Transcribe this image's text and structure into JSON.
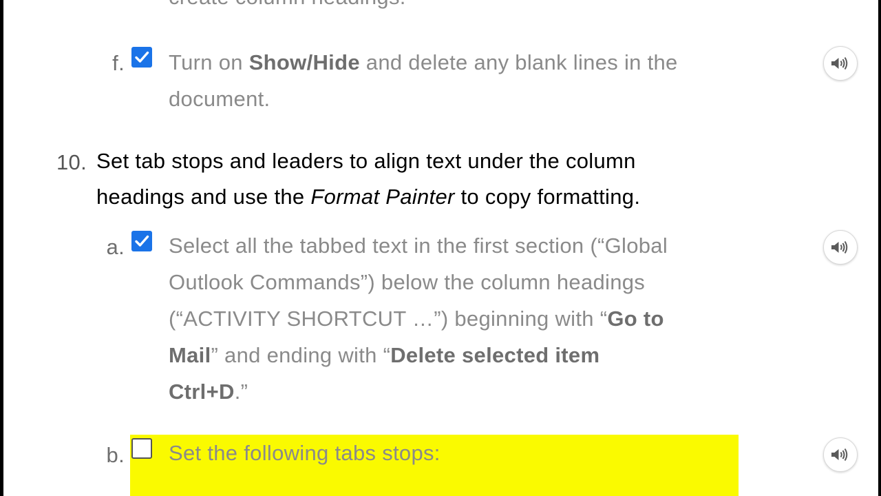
{
  "top_partial_text": "create column headings.",
  "step_f": {
    "marker": "f.",
    "checked": true,
    "text_1": "Turn on ",
    "bold_1": "Show/Hide",
    "text_2": " and delete any blank lines in the",
    "line_2": "document."
  },
  "step_10": {
    "number": "10.",
    "line_1": "Set tab stops and leaders to align text under the column",
    "line_2_a": "headings and use the ",
    "line_2_italic": "Format Painter",
    "line_2_b": " to copy formatting."
  },
  "step_a": {
    "marker": "a.",
    "checked": true,
    "line_1": "Select all the tabbed text in the first section (“Global",
    "line_2": "Outlook Commands”) below the column headings",
    "line_3_a": "(“ACTIVITY SHORTCUT …”) beginning with “",
    "line_3_bold": "Go to",
    "line_4_bold": "Mail",
    "line_4_a": "” and ending with “",
    "line_4_bold_2": "Delete selected item",
    "line_5_bold": "Ctrl+D",
    "line_5_a": ".”"
  },
  "step_b": {
    "marker": "b.",
    "checked": false,
    "text": "Set the following tabs stops:"
  },
  "audio_icon": "speaker-icon",
  "colors": {
    "highlight": "#fafa00",
    "checkbox_checked": "#1a73e8",
    "step_text": "#8a8a8a",
    "main_text": "#000000"
  }
}
